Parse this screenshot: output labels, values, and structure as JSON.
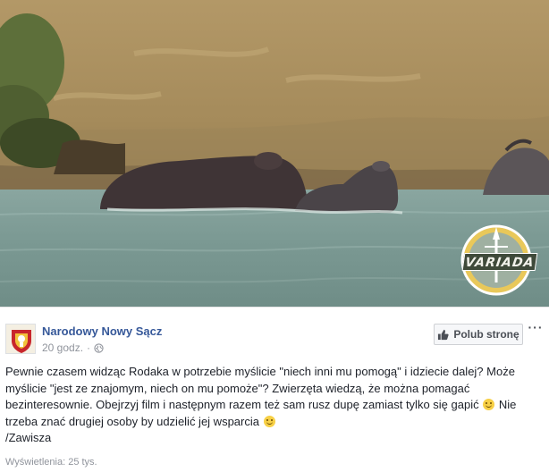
{
  "video": {
    "watermark_text": "VARIADA"
  },
  "post": {
    "page_name": "Narodowy Nowy Sącz",
    "timestamp": "20 godz.",
    "separator": "·",
    "privacy_icon": "globe-icon",
    "like_page_label": "Polub stronę",
    "like_icon": "thumbs-up-icon",
    "more_label": "···",
    "text": {
      "line1": "Pewnie czasem widząc Rodaka w potrzebie myślicie \"niech inni mu pomogą\" i idziecie dalej? Może myślicie \"jest ze znajomym, niech on mu pomoże\"? Zwierzęta wiedzą, że można pomagać bezinteresownie. Obejrzyj film i następnym razem też sam rusz dupę zamiast tylko się gapić",
      "line2": "Nie trzeba znać drugiej osoby by udzielić jej wsparcia",
      "signature": "/Zawisza"
    },
    "views_label": "Wyświetlenia: 25 tys."
  },
  "colors": {
    "link_blue": "#365899",
    "meta_gray": "#90949c",
    "text": "#1d2129"
  }
}
